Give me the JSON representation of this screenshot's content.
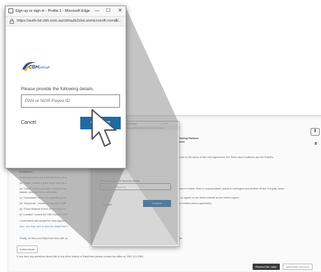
{
  "window": {
    "title": "Sign up or sign in - Profile 1 - Microsoft Edge",
    "url": "https://auth-tst.cbh.com.au/cbhazb2ctst.onmicrosoft.com/b...",
    "minimize": "—",
    "maximize": "☐",
    "close": "✕"
  },
  "logo": {
    "text": "CBH",
    "suffix": "GROUP"
  },
  "form": {
    "prompt": "Please provide the following details.",
    "input_placeholder": "PAN or NGR Payee ID",
    "cancel_label": "Cancel",
    "continue_label": "Continue"
  },
  "background": {
    "heading": "Trading Platform",
    "subheading": "ment",
    "lines": [
      "ound by the terms of this User Agreement, the Terms and Conditions and the Policies.",
      "esent or future, fixed or unascertained, actual or contingent and whether at law, in equity, under",
      "r, or signed on the Seller's behalf as the Seller's agent;",
      "ed entities (where applicable);"
    ],
    "left_lines": [
      "Definitions",
      "In this Agreement the following terms have",
      "(a) \"Buyer\" means a grain buyer that has a",
      "(b) \"Claim\" means any claim, demand, act",
      "statute, contract, tort or otherwise;",
      "(c) \"Consultant\" means an agricultural con",
      "(d) \"DailyGrain\" means Co-operative Bulk",
      "(e) \"Force Majeure Event\" means any eve",
      "(f) \"Location\" means the CBH location whe",
      "I understand and accept the User Agreem",
      "Also, you may wish to view the DailyGrain T"
    ],
    "finally_text": "Finally, so that your DailyGrain links with yo",
    "finally_tail": "ler.",
    "authenticate_label": "Authenticate",
    "questions_text": "If you have any questions about this or any other feature of DailyGrain please contact the office on 1300 113 4364.",
    "remind_label": "Remind Me Later",
    "associate_label": "Associate Account",
    "small_title": "Microsoft Edge",
    "small_url": "cbh.com.au/cbhazb2ctst.onmicrosoft.com/b..."
  }
}
